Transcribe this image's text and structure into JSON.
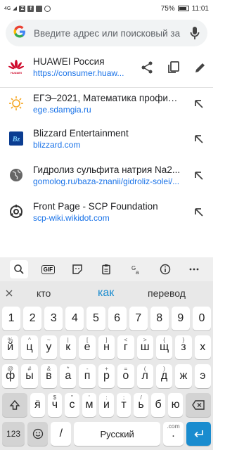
{
  "status": {
    "signal": "4G",
    "battery": "75%",
    "battery_level": 0.75,
    "time": "11:01"
  },
  "search": {
    "placeholder": "Введите адрес или поисковый за",
    "logo": "G"
  },
  "top_result": {
    "title": "HUAWEI Россия",
    "url": "https://consumer.huaw..."
  },
  "suggestions": [
    {
      "title": "ЕГЭ–2021, Математика профил...",
      "url": "ege.sdamgia.ru",
      "icon": "sun-icon"
    },
    {
      "title": "Blizzard Entertainment",
      "url": "blizzard.com",
      "icon": "blizzard-icon"
    },
    {
      "title": "Гидролиз сульфита натрия Na2...",
      "url": "gomolog.ru/baza-znanii/gidroliz-solei/...",
      "icon": "globe-icon"
    },
    {
      "title": "Front Page - SCP Foundation",
      "url": "scp-wiki.wikidot.com",
      "icon": "scp-icon"
    }
  ],
  "keyboard": {
    "toolbar": [
      "search",
      "GIF",
      "sticker",
      "clipboard",
      "translate",
      "info",
      "more"
    ],
    "word_suggestions": {
      "left": "кто",
      "center": "как",
      "right": "перевод"
    },
    "number_row": [
      "1",
      "2",
      "3",
      "4",
      "5",
      "6",
      "7",
      "8",
      "9",
      "0"
    ],
    "row1": [
      {
        "k": "й",
        "s": "%"
      },
      {
        "k": "ц",
        "s": "^"
      },
      {
        "k": "у",
        "s": "~"
      },
      {
        "k": "к",
        "s": "|"
      },
      {
        "k": "е",
        "s": "["
      },
      {
        "k": "н",
        "s": "]"
      },
      {
        "k": "г",
        "s": "<"
      },
      {
        "k": "ш",
        "s": ">"
      },
      {
        "k": "щ",
        "s": "{"
      },
      {
        "k": "з",
        "s": "}"
      },
      {
        "k": "х",
        "s": ""
      }
    ],
    "row2": [
      {
        "k": "ф",
        "s": "@"
      },
      {
        "k": "ы",
        "s": "#"
      },
      {
        "k": "в",
        "s": "&"
      },
      {
        "k": "а",
        "s": "*"
      },
      {
        "k": "п",
        "s": "-"
      },
      {
        "k": "р",
        "s": "+"
      },
      {
        "k": "о",
        "s": "="
      },
      {
        "k": "л",
        "s": "("
      },
      {
        "k": "д",
        "s": ")"
      },
      {
        "k": "ж",
        "s": ""
      },
      {
        "k": "э",
        "s": ""
      }
    ],
    "row3": [
      {
        "k": "я",
        "s": "_"
      },
      {
        "k": "ч",
        "s": "$"
      },
      {
        "k": "с",
        "s": "\""
      },
      {
        "k": "м",
        "s": "'"
      },
      {
        "k": "и",
        "s": ":"
      },
      {
        "k": "т",
        "s": ";"
      },
      {
        "k": "ь",
        "s": "/"
      },
      {
        "k": "б",
        "s": ""
      },
      {
        "k": "ю",
        "s": ""
      }
    ],
    "bottom": {
      "num": "123",
      "slash": "/",
      "space": "Русский",
      "dot": ".",
      "dot_sup": ".com"
    }
  }
}
